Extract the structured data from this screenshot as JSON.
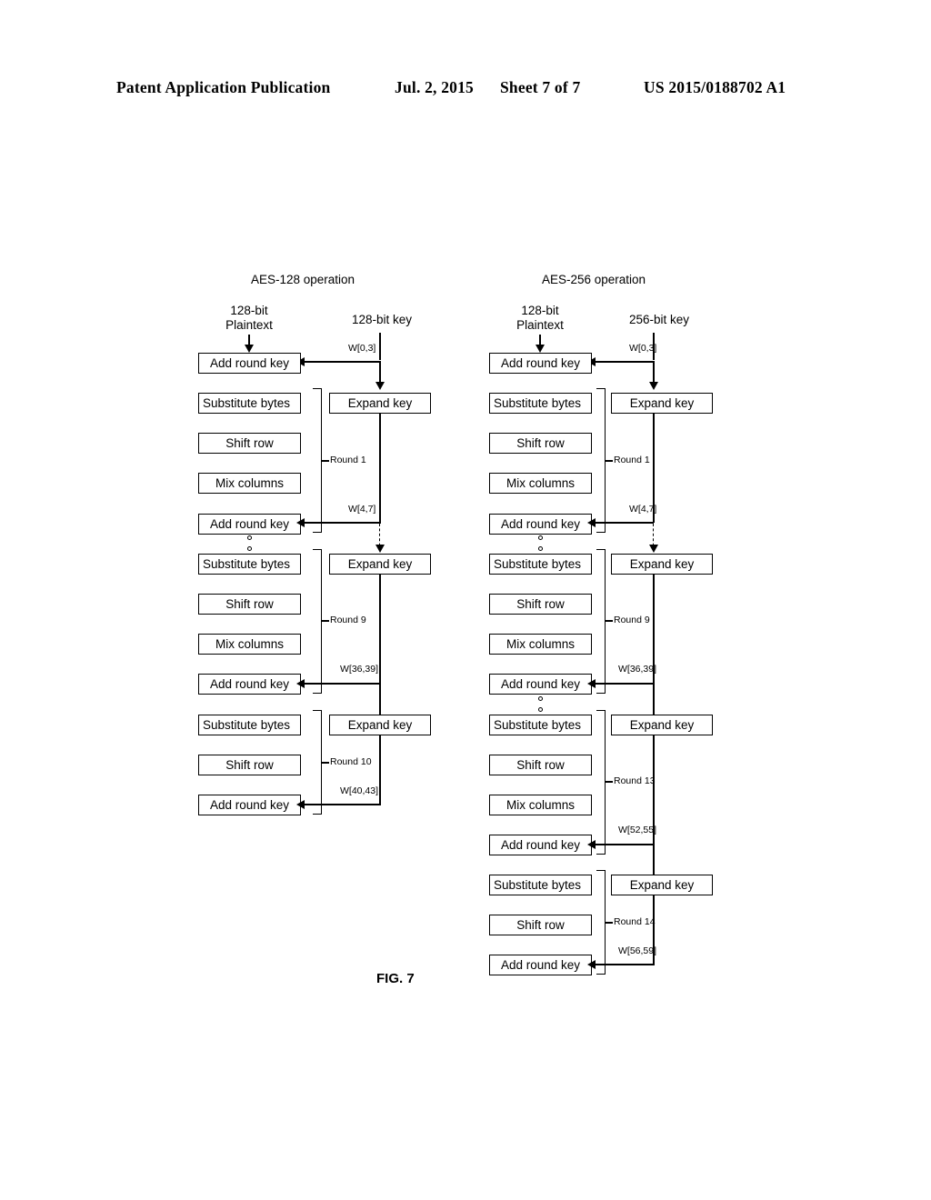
{
  "header": {
    "publication": "Patent Application Publication",
    "date": "Jul. 2, 2015",
    "sheet": "Sheet 7 of 7",
    "number": "US 2015/0188702 A1"
  },
  "figure": {
    "caption": "FIG. 7",
    "columns": [
      {
        "id": "aes128",
        "title": "AES-128 operation",
        "plaintext_label_line1": "128-bit",
        "plaintext_label_line2": "Plaintext",
        "key_label": "128-bit key",
        "initial_box": "Add round key",
        "expand_box": "Expand key",
        "rounds": [
          {
            "name": "Round 1",
            "word_in": "W[0,3]",
            "word_out": "W[4,7]",
            "steps": [
              "Substitute bytes",
              "Shift row",
              "Mix columns",
              "Add round key"
            ]
          },
          {
            "name": "Round 9",
            "word_out": "W[36,39]",
            "steps": [
              "Substitute bytes",
              "Shift row",
              "Mix columns",
              "Add round key"
            ]
          },
          {
            "name": "Round 10",
            "word_out": "W[40,43]",
            "steps": [
              "Substitute bytes",
              "Shift row",
              "Add round key"
            ]
          }
        ]
      },
      {
        "id": "aes256",
        "title": "AES-256 operation",
        "plaintext_label_line1": "128-bit",
        "plaintext_label_line2": "Plaintext",
        "key_label": "256-bit key",
        "initial_box": "Add round key",
        "expand_box": "Expand key",
        "rounds": [
          {
            "name": "Round 1",
            "word_in": "W[0,3]",
            "word_out": "W[4,7]",
            "steps": [
              "Substitute bytes",
              "Shift row",
              "Mix columns",
              "Add round key"
            ]
          },
          {
            "name": "Round 9",
            "word_out": "W[36,39]",
            "steps": [
              "Substitute bytes",
              "Shift row",
              "Mix columns",
              "Add round key"
            ]
          },
          {
            "name": "Round 13",
            "word_out": "W[52,55]",
            "steps": [
              "Substitute bytes",
              "Shift row",
              "Mix columns",
              "Add round key"
            ]
          },
          {
            "name": "Round 14",
            "word_out": "W[56,59]",
            "steps": [
              "Substitute bytes",
              "Shift row",
              "Add round key"
            ]
          }
        ]
      }
    ]
  }
}
